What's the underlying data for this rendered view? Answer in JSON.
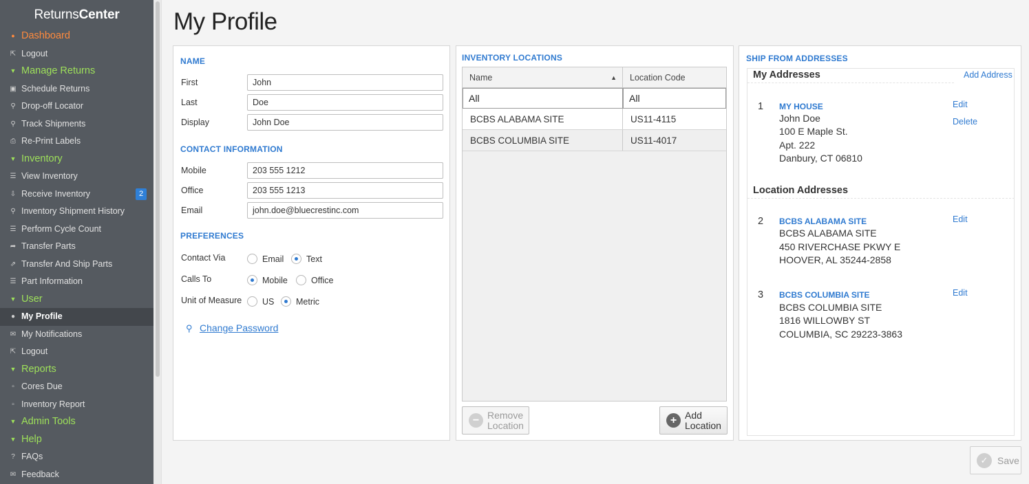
{
  "brand": {
    "part1": "Returns",
    "part2": "Center"
  },
  "sidebar": {
    "items": [
      {
        "label": "Dashboard",
        "icon": "home-icon"
      },
      {
        "label": "Logout",
        "icon": "logout-icon"
      },
      {
        "label": "Manage Returns",
        "icon": "caret-down-icon"
      },
      {
        "label": "Schedule Returns",
        "icon": "truck-icon"
      },
      {
        "label": "Drop-off Locator",
        "icon": "map-pin-icon"
      },
      {
        "label": "Track Shipments",
        "icon": "search-icon"
      },
      {
        "label": "Re-Print Labels",
        "icon": "printer-icon"
      },
      {
        "label": "Inventory",
        "icon": "caret-down-icon"
      },
      {
        "label": "View Inventory",
        "icon": "list-icon"
      },
      {
        "label": "Receive Inventory",
        "icon": "download-icon",
        "badge": "2"
      },
      {
        "label": "Inventory Shipment History",
        "icon": "search-icon"
      },
      {
        "label": "Perform Cycle Count",
        "icon": "list-icon"
      },
      {
        "label": "Transfer Parts",
        "icon": "share-icon"
      },
      {
        "label": "Transfer And Ship Parts",
        "icon": "external-icon"
      },
      {
        "label": "Part Information",
        "icon": "list-icon"
      },
      {
        "label": "User",
        "icon": "caret-down-icon"
      },
      {
        "label": "My Profile",
        "icon": "user-icon"
      },
      {
        "label": "My Notifications",
        "icon": "envelope-icon"
      },
      {
        "label": "Logout",
        "icon": "logout-icon"
      },
      {
        "label": "Reports",
        "icon": "caret-down-icon"
      },
      {
        "label": "Cores Due",
        "icon": "file-icon"
      },
      {
        "label": "Inventory Report",
        "icon": "file-icon"
      },
      {
        "label": "Admin Tools",
        "icon": "caret-down-icon"
      },
      {
        "label": "Help",
        "icon": "caret-down-icon"
      },
      {
        "label": "FAQs",
        "icon": "question-icon"
      },
      {
        "label": "Feedback",
        "icon": "envelope-outline-icon"
      }
    ]
  },
  "page_title": "My Profile",
  "profile": {
    "name_title": "NAME",
    "first_label": "First",
    "first_value": "John",
    "last_label": "Last",
    "last_value": "Doe",
    "display_label": "Display",
    "display_value": "John Doe",
    "contact_title": "CONTACT INFORMATION",
    "mobile_label": "Mobile",
    "mobile_value": "203 555 1212",
    "office_label": "Office",
    "office_value": "203 555 1213",
    "email_label": "Email",
    "email_value": "john.doe@bluecrestinc.com",
    "prefs_title": "PREFERENCES",
    "contact_via_label": "Contact Via",
    "contact_via_options": [
      "Email",
      "Text"
    ],
    "contact_via_selected": "Text",
    "calls_to_label": "Calls To",
    "calls_to_options": [
      "Mobile",
      "Office"
    ],
    "calls_to_selected": "Mobile",
    "uom_label": "Unit of Measure",
    "uom_options": [
      "US",
      "Metric"
    ],
    "uom_selected": "Metric",
    "change_password": "Change Password"
  },
  "inventory": {
    "title": "INVENTORY LOCATIONS",
    "columns": [
      "Name",
      "Location Code"
    ],
    "filters": [
      "All",
      "All"
    ],
    "rows": [
      [
        "BCBS ALABAMA SITE",
        "US11-4115"
      ],
      [
        "BCBS COLUMBIA SITE",
        "US11-4017"
      ]
    ],
    "remove_l1": "Remove",
    "remove_l2": "Location",
    "add_l1": "Add",
    "add_l2": "Location"
  },
  "shipfrom": {
    "title": "SHIP FROM ADDRESSES",
    "my_addresses": "My Addresses",
    "add_address": "Add Address",
    "location_addresses": "Location Addresses",
    "edit_label": "Edit",
    "delete_label": "Delete",
    "addresses": [
      {
        "num": "1",
        "name": "MY HOUSE",
        "lines": [
          "John Doe",
          "100 E Maple St.",
          "Apt. 222",
          "Danbury, CT 06810"
        ]
      },
      {
        "num": "2",
        "name": "BCBS ALABAMA SITE",
        "lines": [
          "BCBS ALABAMA SITE",
          "450 RIVERCHASE PKWY E",
          "HOOVER, AL 35244-2858"
        ]
      },
      {
        "num": "3",
        "name": "BCBS COLUMBIA SITE",
        "lines": [
          "BCBS COLUMBIA SITE",
          "1816 WILLOWBY ST",
          "COLUMBIA, SC 29223-3863"
        ]
      }
    ]
  },
  "save_label": "Save",
  "colors": {
    "sidebar_bg": "#555a60",
    "section_green": "#9ee15a",
    "active_orange": "#ff8a3d",
    "link_blue": "#2f7ad0",
    "badge_blue": "#2f80d8"
  }
}
